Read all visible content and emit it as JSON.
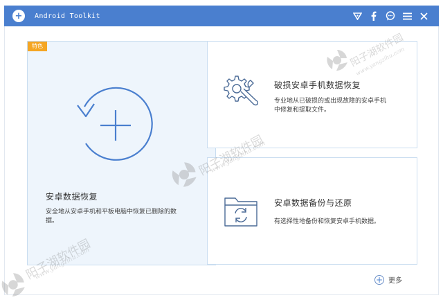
{
  "titlebar": {
    "app_title": "Android Toolkit",
    "icons": [
      "wifi-triangle-icon",
      "facebook-icon",
      "chat-icon",
      "menu-icon",
      "close-icon"
    ]
  },
  "main_card": {
    "badge": "特色",
    "title": "安卓数据恢复",
    "description": "安全地从安卓手机和平板电脑中恢复已删除的数据。"
  },
  "features": [
    {
      "title": "破损安卓手机数据恢复",
      "description": "专业地从已破损的或出现故障的安卓手机中修复和提取文件。"
    },
    {
      "title": "安卓数据备份与还原",
      "description": "有选择性地备份和恢复安卓手机数据。"
    }
  ],
  "more_label": "更多",
  "watermark": {
    "text": "阳子湖软件园",
    "url": "www.yangzihu.com"
  },
  "colors": {
    "accent": "#4a7fcf",
    "badge": "#f5a623",
    "card_bg": "#eef5fc"
  }
}
